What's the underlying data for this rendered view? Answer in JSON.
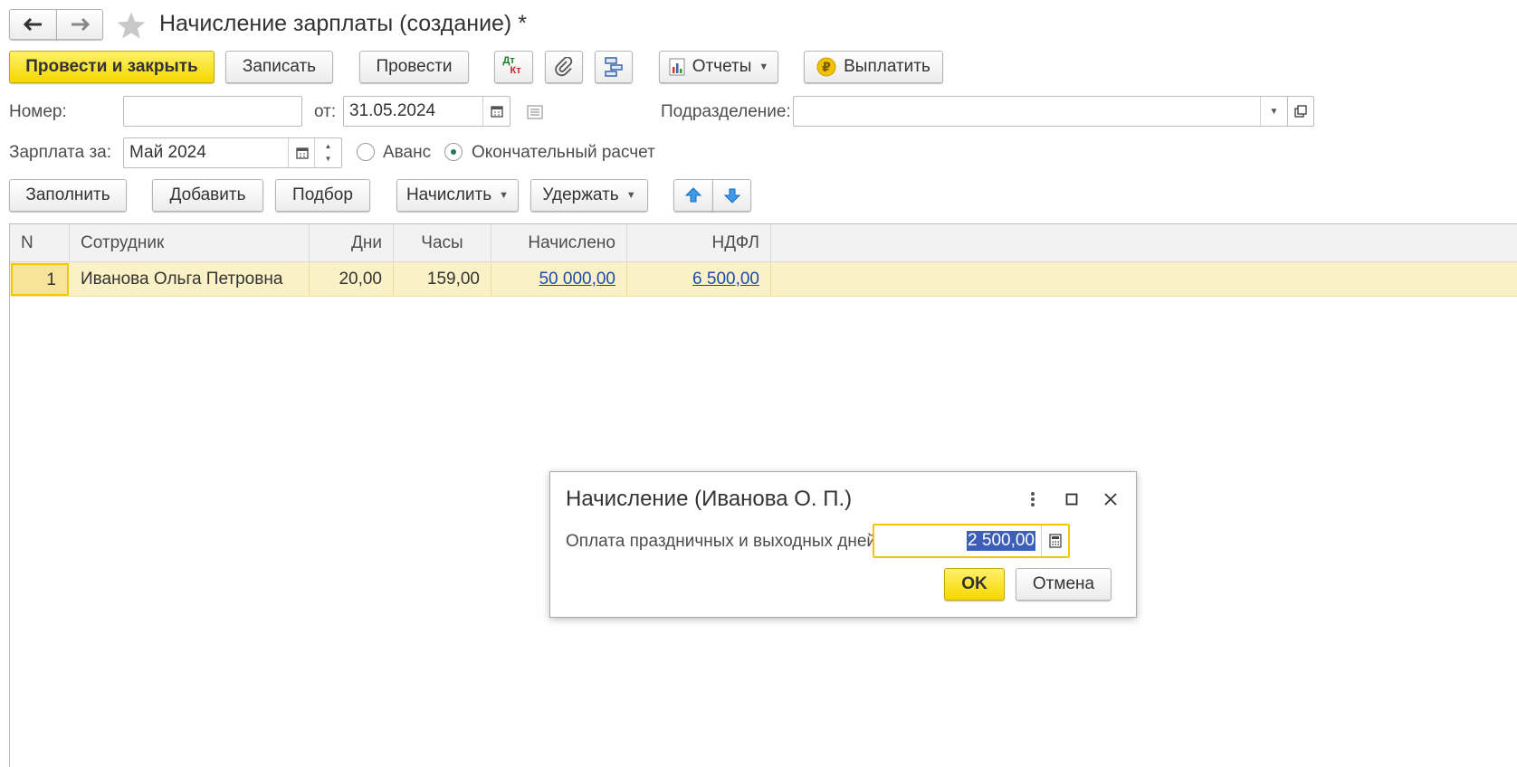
{
  "window": {
    "title": "Начисление зарплаты (создание) *"
  },
  "nav": {
    "back_icon": "arrow-left-icon",
    "forward_icon": "arrow-right-icon",
    "favorite_icon": "star-icon"
  },
  "toolbar": {
    "post_close_label": "Провести и закрыть",
    "save_label": "Записать",
    "post_label": "Провести",
    "dt_label": "Дт",
    "kt_label": "Кт",
    "reports_label": "Отчеты",
    "pay_label": "Выплатить"
  },
  "header_fields": {
    "number_label": "Номер:",
    "number_value": "",
    "date_label": "от:",
    "date_value": "31.05.2024",
    "division_label": "Подразделение:",
    "division_value": "",
    "salary_for_label": "Зарплата за:",
    "salary_for_value": "Май 2024",
    "advance_label": "Аванс",
    "final_label": "Окончательный расчет",
    "selected_payment_type": "final"
  },
  "table_toolbar": {
    "fill_label": "Заполнить",
    "add_label": "Добавить",
    "pick_label": "Подбор",
    "accrue_label": "Начислить",
    "deduct_label": "Удержать"
  },
  "table": {
    "columns": [
      "N",
      "Сотрудник",
      "Дни",
      "Часы",
      "Начислено",
      "НДФЛ"
    ],
    "rows": [
      {
        "n": "1",
        "employee": "Иванова Ольга Петровна",
        "days": "20,00",
        "hours": "159,00",
        "accrued": "50 000,00",
        "ndfl": "6 500,00"
      }
    ]
  },
  "dialog": {
    "title": "Начисление (Иванова О. П.)",
    "field_label": "Оплата праздничных и выходных дней:",
    "field_value": "2 500,00",
    "ok_label": "OK",
    "cancel_label": "Отмена"
  },
  "colors": {
    "accent_yellow": "#f5d800",
    "row_highlight": "#fbf1c6",
    "link_blue": "#1b4bb0",
    "selection_blue": "#3d5fb8"
  }
}
